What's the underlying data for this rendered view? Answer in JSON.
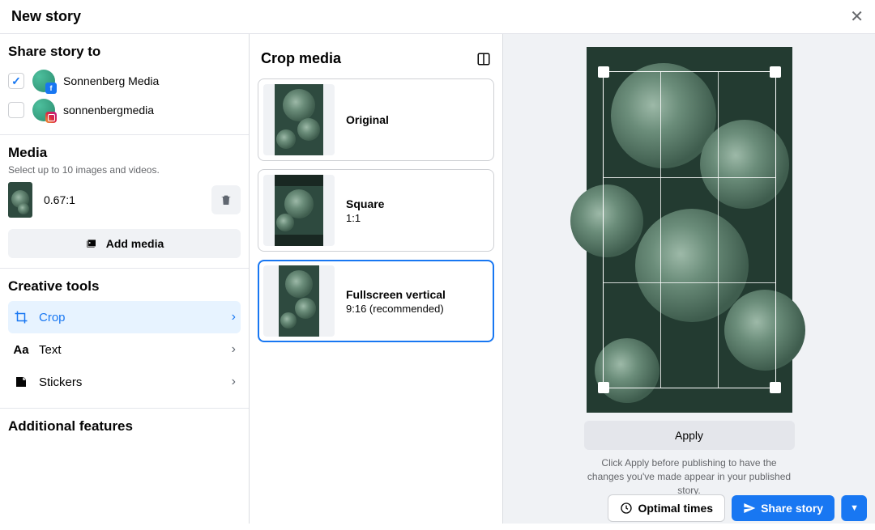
{
  "header": {
    "title": "New story"
  },
  "share": {
    "title": "Share story to",
    "accounts": [
      {
        "name": "Sonnenberg Media",
        "checked": true,
        "platform": "fb"
      },
      {
        "name": "sonnenbergmedia",
        "checked": false,
        "platform": "ig"
      }
    ]
  },
  "media": {
    "title": "Media",
    "subtitle": "Select up to 10 images and videos.",
    "items": [
      {
        "ratio": "0.67:1"
      }
    ],
    "add_label": "Add media"
  },
  "tools": {
    "title": "Creative tools",
    "items": [
      {
        "label": "Crop",
        "active": true
      },
      {
        "label": "Text",
        "active": false
      },
      {
        "label": "Stickers",
        "active": false
      }
    ]
  },
  "additional": {
    "title": "Additional features"
  },
  "crop": {
    "title": "Crop media",
    "options": [
      {
        "name": "Original",
        "ratio": ""
      },
      {
        "name": "Square",
        "ratio": "1:1"
      },
      {
        "name": "Fullscreen vertical",
        "ratio": "9:16 (recommended)"
      }
    ],
    "apply_label": "Apply",
    "apply_hint": "Click Apply before publishing to have the changes you've made appear in your published story."
  },
  "footer": {
    "optimal_label": "Optimal times",
    "share_label": "Share story"
  }
}
